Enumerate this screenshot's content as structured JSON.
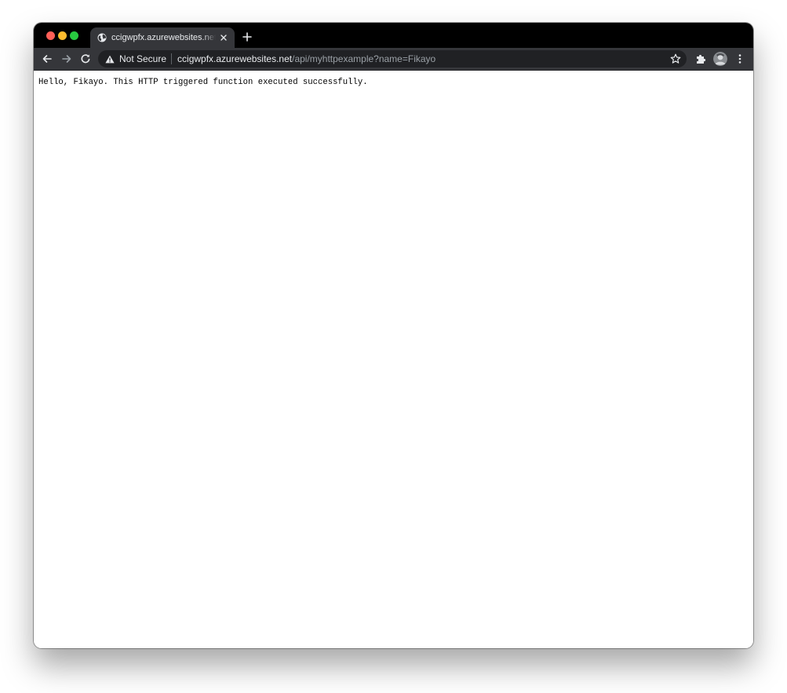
{
  "window": {
    "title_bar": "mac-window-chrome"
  },
  "tab": {
    "title": "ccigwpfx.azurewebsites.net/api/myhttpexample?name=Fikayo",
    "favicon": "globe-icon"
  },
  "toolbar": {
    "security_label": "Not Secure",
    "url_host": "ccigwpfx.azurewebsites.net",
    "url_path": "/api/myhttpexample?name=Fikayo"
  },
  "page": {
    "body_text": "Hello, Fikayo. This HTTP triggered function executed successfully."
  },
  "colors": {
    "titlebar": "#000000",
    "toolbar": "#35363a",
    "omnibox": "#202124",
    "text_light": "#e8eaed",
    "text_dim": "#9aa0a6",
    "close": "#ff5f57",
    "minimize": "#febc2e",
    "maximize": "#28c840"
  }
}
